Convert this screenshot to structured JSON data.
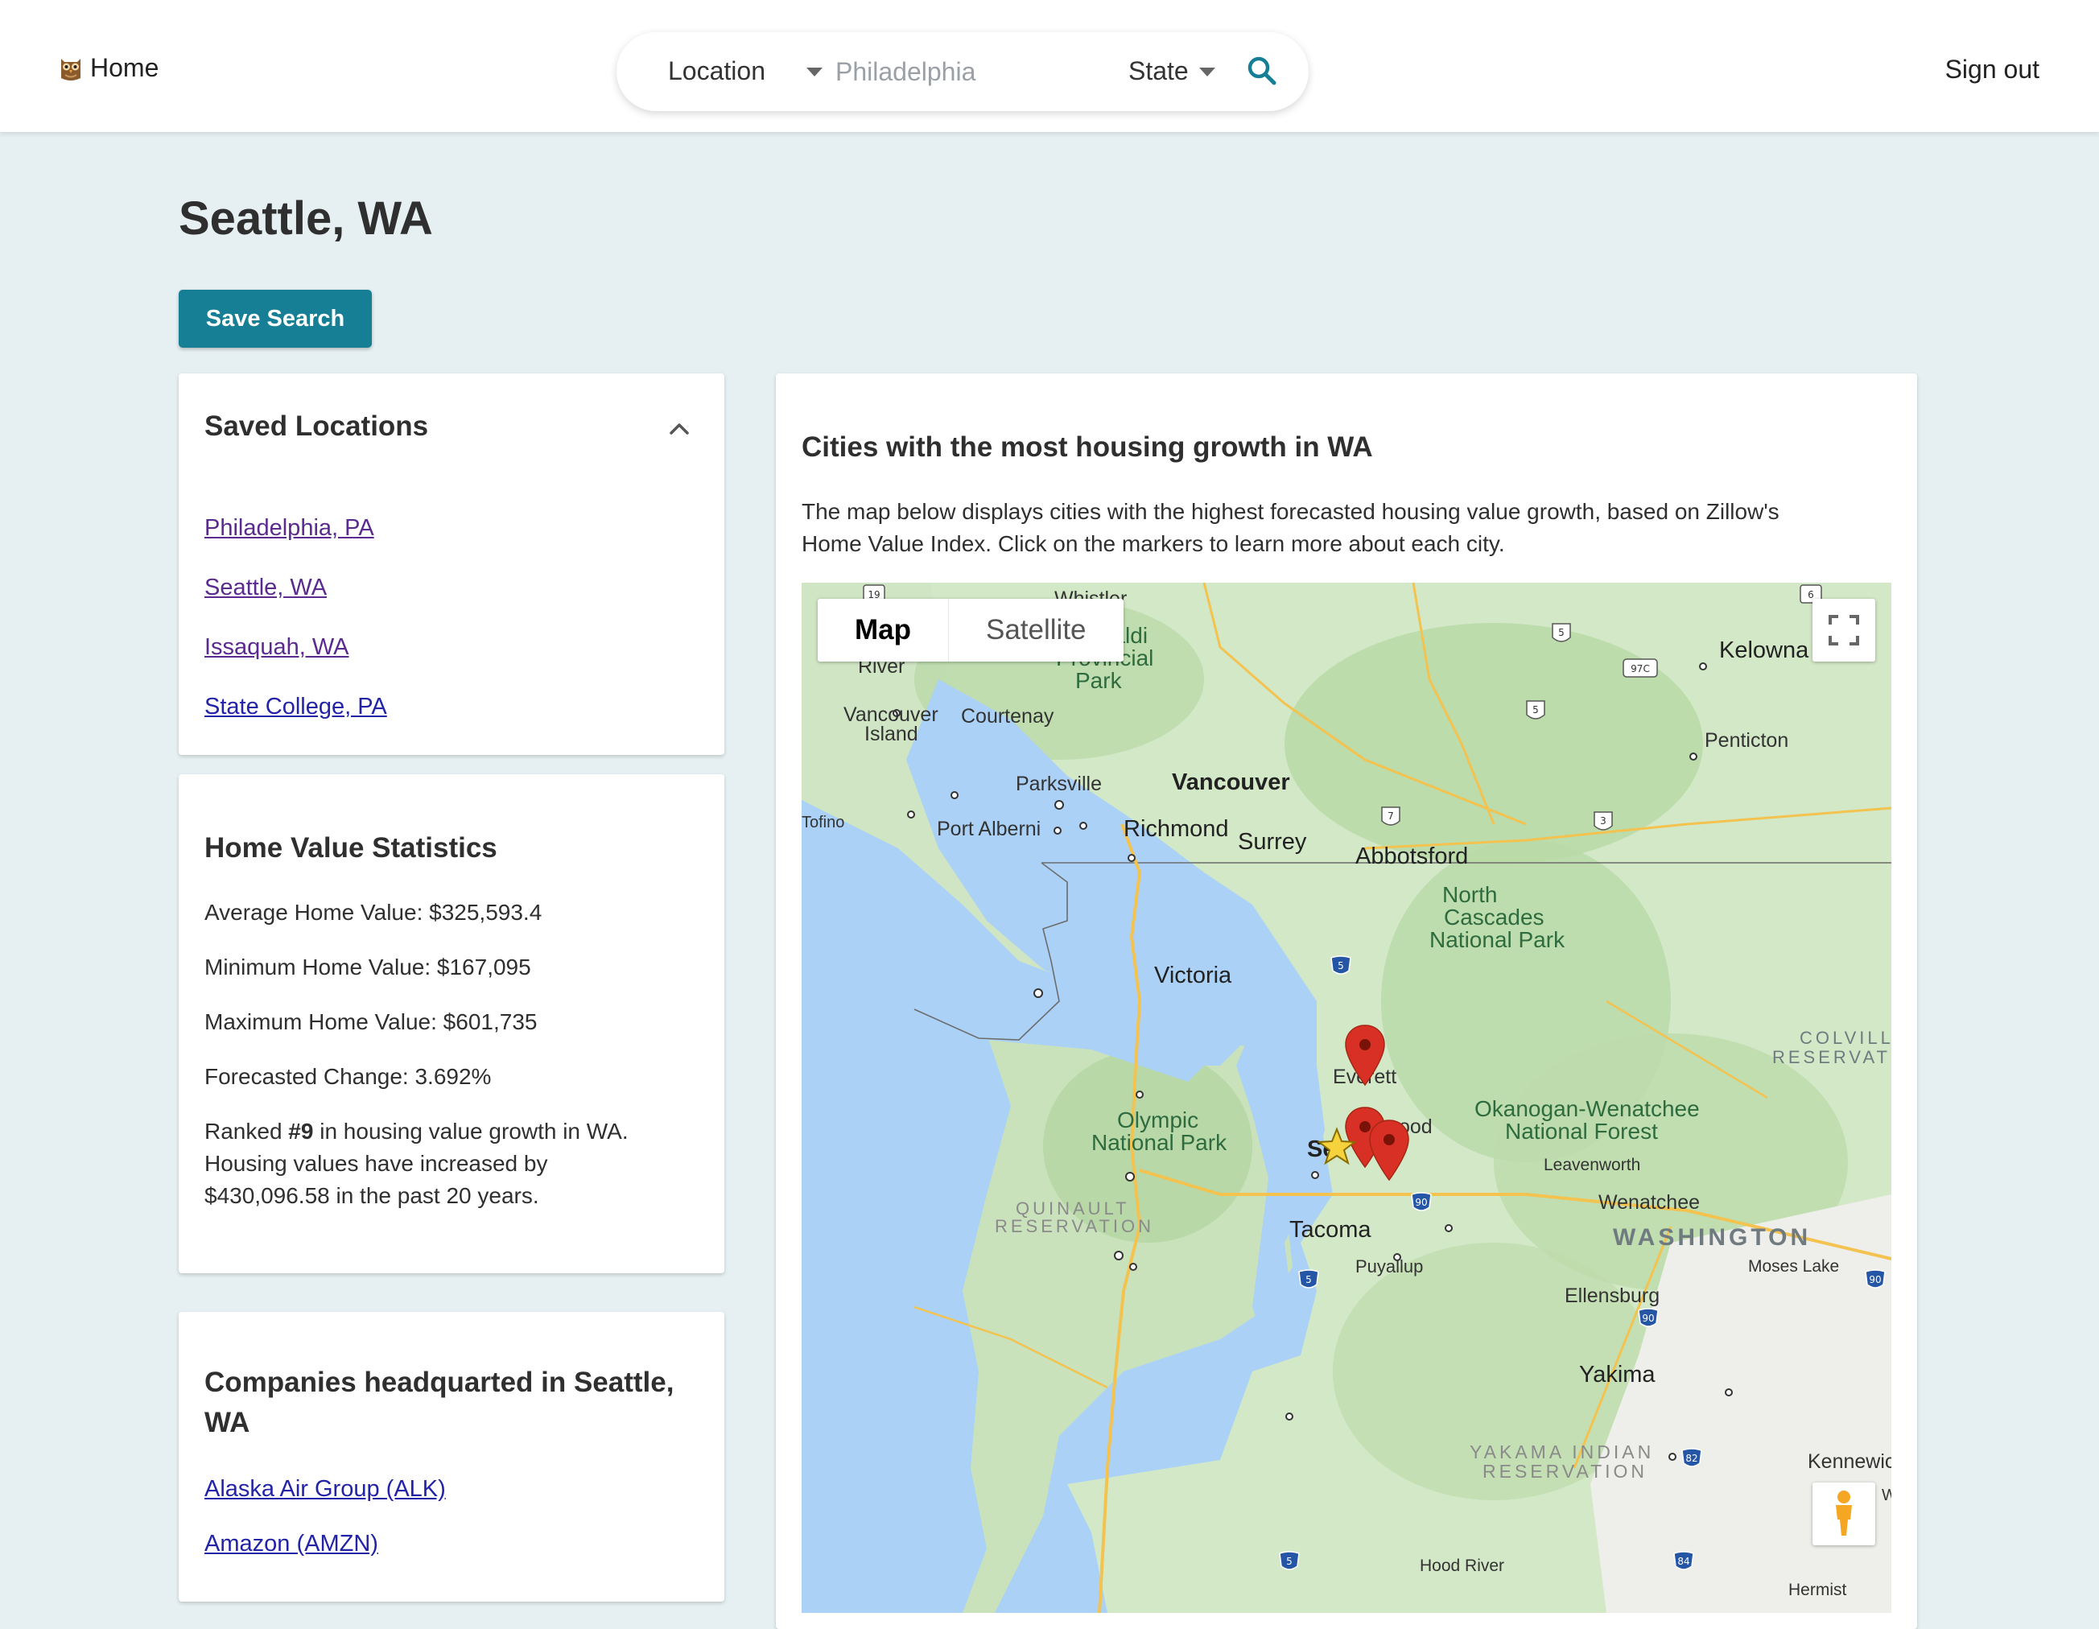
{
  "nav": {
    "home_label": "Home",
    "location_label": "Location",
    "location_placeholder": "Philadelphia",
    "state_label": "State",
    "signout_label": "Sign out"
  },
  "page": {
    "title": "Seattle, WA",
    "save_button": "Save Search"
  },
  "saved_locations": {
    "title": "Saved Locations",
    "items": [
      "Philadelphia, PA",
      "Seattle, WA",
      "Issaquah, WA",
      "State College, PA"
    ]
  },
  "stats": {
    "title": "Home Value Statistics",
    "average": "Average Home Value: $325,593.4",
    "minimum": "Minimum Home Value: $167,095",
    "maximum": "Maximum Home Value: $601,735",
    "forecast": "Forecasted Change: 3.692%",
    "rank_prefix": "Ranked ",
    "rank": "#9",
    "rank_suffix": " in housing value growth in WA.",
    "growth_line1": "Housing values have increased by",
    "growth_line2": "$430,096.58 in the past 20 years."
  },
  "companies": {
    "title_line1": "Companies headquarted in Seattle,",
    "title_line2": "WA",
    "items": [
      "Alaska Air Group (ALK)",
      "Amazon (AMZN)"
    ]
  },
  "map_card": {
    "title": "Cities with the most housing growth in WA",
    "desc_line1": "The map below displays cities with the highest forecasted housing value growth, based on Zillow's",
    "desc_line2": "Home Value Index. Click on the markers to learn more about each city.",
    "map_type": {
      "map": "Map",
      "satellite": "Satellite"
    },
    "labels": {
      "whistler": "Whistler",
      "garibaldi1": "Garibaldi",
      "garibaldi2": "Provincial",
      "garibaldi3": "Park",
      "river": "River",
      "vancouver_island1": "Vancouver",
      "vancouver_island2": "Island",
      "courtenay": "Courtenay",
      "kelowna": "Kelowna",
      "penticton": "Penticton",
      "parksville": "Parksville",
      "vancouver": "Vancouver",
      "tofino": "Tofino",
      "port_alberni": "Port Alberni",
      "richmond": "Richmond",
      "surrey": "Surrey",
      "abbotsford": "Abbotsford",
      "north_cascades1": "North",
      "north_cascades2": "Cascades",
      "north_cascades3": "National Park",
      "victoria": "Victoria",
      "colville1": "COLVILL",
      "colville2": "RESERVAT",
      "everett": "Everett",
      "okanogan1": "Okanogan-Wenatchee",
      "okanogan2": "National Forest",
      "olympic1": "Olympic",
      "olympic2": "National Park",
      "seattle": "Se",
      "redmond": "ood",
      "leavenworth": "Leavenworth",
      "wenatchee": "Wenatchee",
      "quinault1": "QUINAULT",
      "quinault2": "RESERVATION",
      "tacoma": "Tacoma",
      "washington": "WASHINGTON",
      "moses_lake": "Moses Lake",
      "puyallup": "Puyallup",
      "ellensburg": "Ellensburg",
      "yakima": "Yakima",
      "yakama1": "YAKAMA INDIAN",
      "yakama2": "RESERVATION",
      "kennewick": "Kennewick",
      "hermiston": "Hermist",
      "hood_river": "Hood River",
      "w": "W"
    },
    "shields": [
      "19",
      "6",
      "5",
      "97C",
      "5",
      "7",
      "3",
      "5",
      "90",
      "5",
      "90",
      "90",
      "82",
      "5",
      "84"
    ]
  },
  "colors": {
    "accent": "#167f95",
    "background": "#e6f0f2",
    "link": "#2323a8",
    "visited_link": "#5a2a8e",
    "marker": "#d93025"
  },
  "icons": {
    "home": "owl-logo-icon",
    "search": "search-icon",
    "collapse": "chevron-up-icon",
    "fullscreen": "fullscreen-icon",
    "pegman": "street-view-pegman-icon",
    "marker": "map-marker-icon",
    "selected": "star-marker-icon"
  }
}
